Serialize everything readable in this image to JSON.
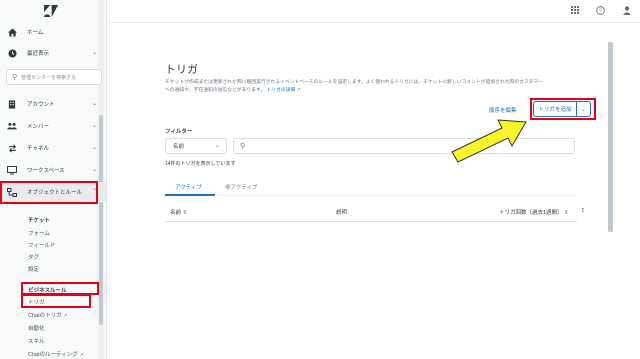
{
  "sidebar": {
    "home": "ホーム",
    "recent": "最近表示",
    "search_placeholder": "管理センターを検索する",
    "account": "アカウント",
    "members": "メンバー",
    "channels": "チャネル",
    "workspaces": "ワークスペース",
    "objects_rules": "オブジェクトとルール",
    "tickets_heading": "チケット",
    "tickets_items": [
      "フォーム",
      "フィールド",
      "タグ",
      "設定"
    ],
    "business_rules_heading": "ビジネスルール",
    "business_rules_items": [
      "トリガ",
      "Chatのトリガ",
      "自動化",
      "スキル",
      "Chatのルーティング"
    ]
  },
  "main": {
    "title": "トリガ",
    "description": "チケットが作成または更新された際に毎回実行されるイベントベースのルールを設定します。よく使われるトリガには、チケットに新しいコメントが追加された際のカスタマーへの通知や、不在通知の送信などがあります。",
    "description_link": "トリガの詳細",
    "edit_order": "順序を編集",
    "add_trigger": "トリガを追加",
    "filter_label": "フィルター",
    "filter_select": "名前",
    "count_text": "14件のトリガを表示しています",
    "tabs": [
      "アクティブ",
      "非アクティブ"
    ],
    "columns": {
      "name": "名前",
      "description": "説明",
      "usage": "トリガ回数（過去1週間）"
    }
  },
  "colors": {
    "accent": "#1f73b7",
    "highlight_box": "#e3001b",
    "arrow_fill": "#f5f52a"
  }
}
